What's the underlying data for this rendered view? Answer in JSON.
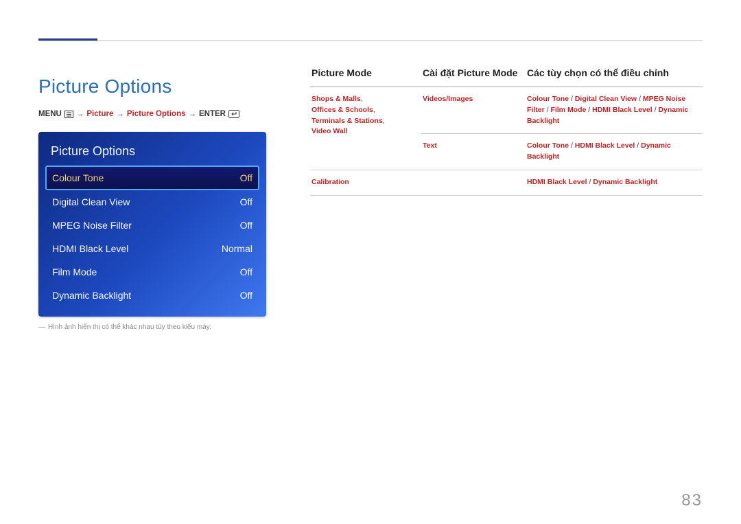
{
  "page": {
    "title": "Picture Options",
    "breadcrumb": {
      "menu_label": "MENU",
      "level1": "Picture",
      "level2": "Picture Options",
      "enter_label": "ENTER"
    },
    "note": "Hình ảnh hiển thị có thể khác nhau tùy theo kiểu máy.",
    "number": "83"
  },
  "menu": {
    "title": "Picture Options",
    "rows": [
      {
        "label": "Colour Tone",
        "value": "Off",
        "selected": true
      },
      {
        "label": "Digital Clean View",
        "value": "Off",
        "selected": false
      },
      {
        "label": "MPEG Noise Filter",
        "value": "Off",
        "selected": false
      },
      {
        "label": "HDMI Black Level",
        "value": "Normal",
        "selected": false
      },
      {
        "label": "Film Mode",
        "value": "Off",
        "selected": false
      },
      {
        "label": "Dynamic Backlight",
        "value": "Off",
        "selected": false
      }
    ]
  },
  "table": {
    "headers": {
      "c1": "Picture Mode",
      "c2": "Cài đặt Picture Mode",
      "c3": "Các tùy chọn có thể điều chỉnh"
    },
    "rows": [
      {
        "mode_html": "Shops & Malls, Offices & Schools, Terminals & Stations, Video Wall",
        "sub": [
          {
            "setting": "Videos/Images",
            "opts": [
              "Colour Tone",
              "Digital Clean View",
              "MPEG Noise Filter",
              "Film Mode",
              "HDMI Black Level",
              "Dynamic Backlight"
            ]
          },
          {
            "setting": "Text",
            "opts": [
              "Colour Tone",
              "HDMI Black Level",
              "Dynamic Backlight"
            ]
          }
        ]
      },
      {
        "mode_html": "Calibration",
        "sub": [
          {
            "setting": "",
            "opts": [
              "HDMI Black Level",
              "Dynamic Backlight"
            ]
          }
        ]
      }
    ]
  }
}
